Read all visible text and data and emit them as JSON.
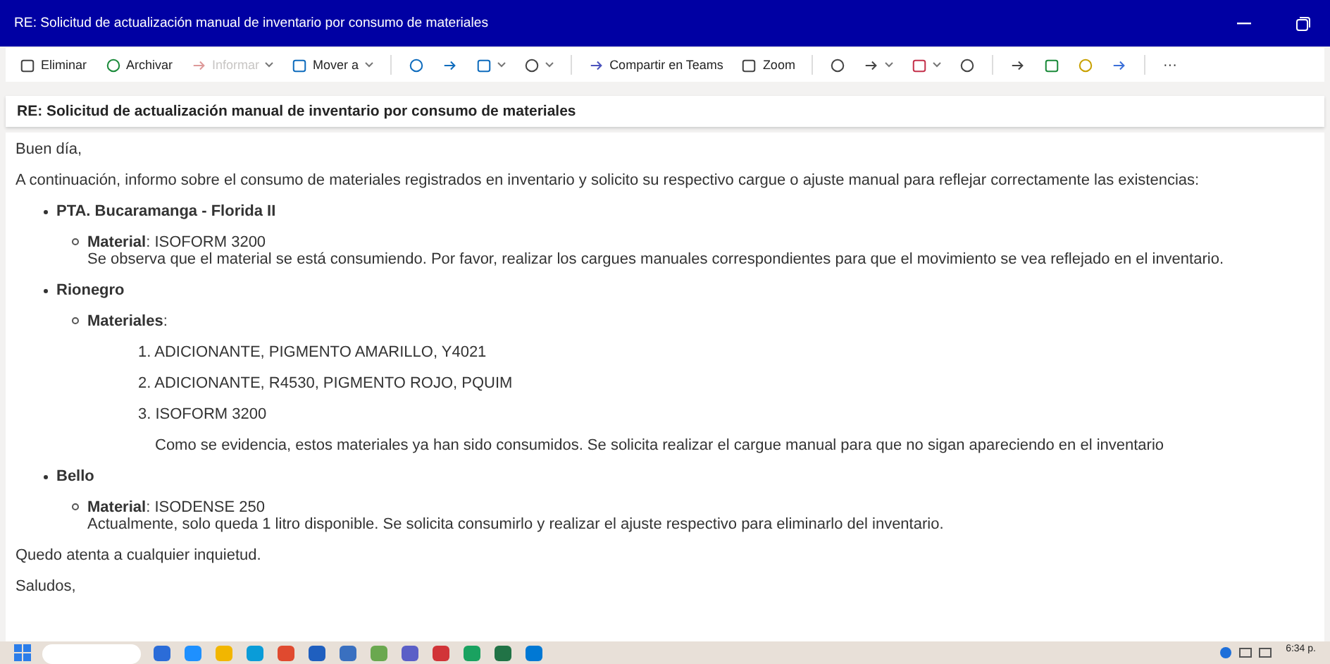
{
  "window": {
    "title": "RE: Solicitud de actualización manual de inventario por consumo de materiales"
  },
  "toolbar": [
    {
      "kind": "labeled",
      "label": "Eliminar",
      "disabled": false,
      "dropdown": false
    },
    {
      "kind": "labeled",
      "label": "Archivar",
      "disabled": false,
      "dropdown": false
    },
    {
      "kind": "labeled",
      "label": "Informar",
      "disabled": true,
      "dropdown": true
    },
    {
      "kind": "labeled",
      "label": "Mover a",
      "disabled": false,
      "dropdown": true
    },
    {
      "kind": "icon",
      "disabled": false,
      "dropdown": false
    },
    {
      "kind": "icon",
      "disabled": false,
      "dropdown": false
    },
    {
      "kind": "icon",
      "disabled": false,
      "dropdown": true
    },
    {
      "kind": "icon",
      "disabled": false,
      "dropdown": true
    },
    {
      "kind": "labeled",
      "label": "Compartir en Teams",
      "disabled": false,
      "dropdown": false
    },
    {
      "kind": "labeled",
      "label": "Zoom",
      "disabled": false,
      "dropdown": false
    },
    {
      "kind": "icon",
      "disabled": false,
      "dropdown": false
    },
    {
      "kind": "icon",
      "disabled": false,
      "dropdown": true
    },
    {
      "kind": "icon",
      "disabled": false,
      "dropdown": true
    },
    {
      "kind": "icon",
      "disabled": false,
      "dropdown": false
    },
    {
      "kind": "icon",
      "disabled": false,
      "dropdown": false
    },
    {
      "kind": "icon",
      "disabled": false,
      "dropdown": false
    },
    {
      "kind": "icon",
      "disabled": false,
      "dropdown": false
    },
    {
      "kind": "icon",
      "disabled": false,
      "dropdown": false
    },
    {
      "kind": "text",
      "label": "···",
      "disabled": false,
      "dropdown": false
    }
  ],
  "subject": "RE: Solicitud de actualización manual de inventario  por consumo de materiales",
  "body": [
    {
      "kind": "paragraph",
      "text": "Buen día,"
    },
    {
      "kind": "paragraph",
      "text": "A continuación, informo sobre el consumo de materiales registrados en inventario y solicito su respectivo cargue o ajuste manual para reflejar correctamente las existencias:"
    },
    {
      "kind": "site",
      "name": "PTA. Bucaramanga - Florida II",
      "details": [
        {
          "text": "**Material**: ISOFORM 3200",
          "note": "Se observa que el material se está consumiendo. Por favor, realizar los cargues manuales correspondientes para que el movimiento se vea reflejado en el inventario."
        }
      ]
    },
    {
      "kind": "site",
      "name": "Rionegro",
      "details": [
        {
          "text": "**Materiales**:",
          "items": [
            "1. ADICIONANTE, PIGMENTO AMARILLO, Y4021",
            "2. ADICIONANTE, R4530, PIGMENTO ROJO, PQUIM",
            "3. ISOFORM 3200"
          ],
          "after": "Como se evidencia, estos materiales ya han sido consumidos. Se solicita realizar el cargue manual para que no sigan apareciendo en el inventario"
        }
      ]
    },
    {
      "kind": "site",
      "name": "Bello",
      "details": [
        {
          "text": "**Material**: ISODENSE 250",
          "note": "Actualmente, solo queda 1 litro disponible. Se solicita consumirlo y realizar el ajuste respectivo para eliminarlo del inventario."
        }
      ]
    },
    {
      "kind": "paragraph",
      "text": "Quedo atenta a cualquier inquietud."
    },
    {
      "kind": "paragraph",
      "text": "Saludos,"
    }
  ],
  "taskbar": {
    "clock": "6:34 p."
  }
}
